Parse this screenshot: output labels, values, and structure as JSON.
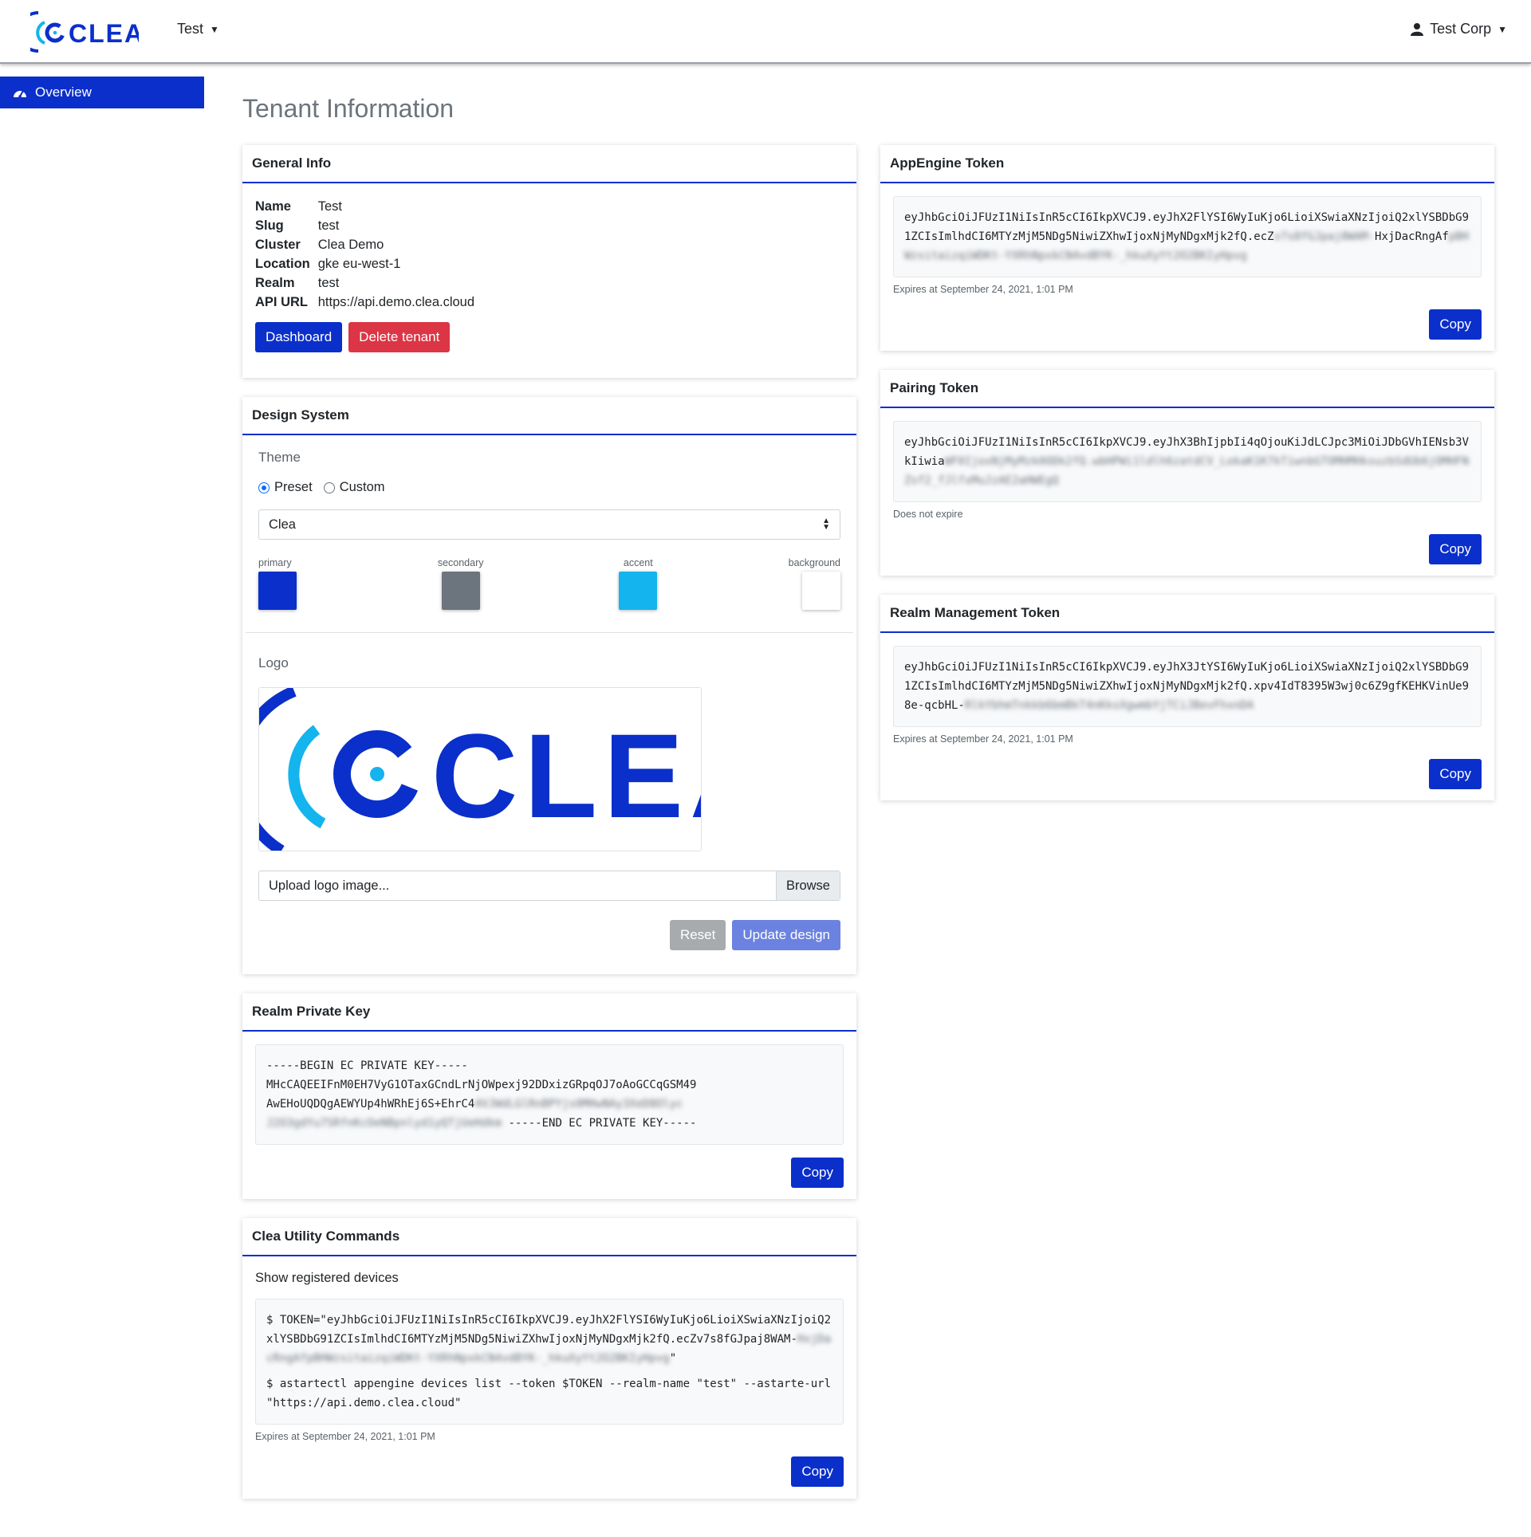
{
  "header": {
    "tenant_selector": "Test",
    "user_menu": "Test Corp"
  },
  "sidebar": {
    "items": [
      {
        "label": "Overview",
        "icon": "dashboard-icon"
      }
    ]
  },
  "page": {
    "title": "Tenant Information"
  },
  "general_info": {
    "title": "General Info",
    "fields": [
      {
        "key": "Name",
        "value": "Test"
      },
      {
        "key": "Slug",
        "value": "test"
      },
      {
        "key": "Cluster",
        "value": "Clea Demo"
      },
      {
        "key": "Location",
        "value": "gke eu-west-1"
      },
      {
        "key": "Realm",
        "value": "test"
      },
      {
        "key": "API URL",
        "value": "https://api.demo.clea.cloud"
      }
    ],
    "dashboard_button": "Dashboard",
    "delete_button": "Delete tenant"
  },
  "design_system": {
    "title": "Design System",
    "theme_label": "Theme",
    "preset_label": "Preset",
    "custom_label": "Custom",
    "selected_theme": "Clea",
    "swatches": [
      {
        "label": "primary",
        "color": "#0a2fca"
      },
      {
        "label": "secondary",
        "color": "#6c757d"
      },
      {
        "label": "accent",
        "color": "#14b4ee"
      },
      {
        "label": "background",
        "color": "#ffffff"
      }
    ],
    "logo_label": "Logo",
    "logo_text": "CLEA",
    "upload_placeholder": "Upload logo image...",
    "browse_label": "Browse",
    "reset_button": "Reset",
    "update_button": "Update design"
  },
  "realm_private_key": {
    "title": "Realm Private Key",
    "line1": "-----BEGIN EC PRIVATE KEY-----",
    "line2": "MHcCAQEEIFnM0EH7VyG1OTaxGCndLrNjOWpexj92DDxizGRpqOJ7oAoGCCqGSM49",
    "line3a": "AwEHoUQDQgAEWYUp4hWRhEj6S+EhrC4",
    "line3b": "4VJWdLGlRnBPYjs0MHwNAy3XeD8Olyc",
    "line4a": "J2O3gdYu7SRfnKcOeNBpnlyd1yQTjUeHdkm",
    "line4b": " -----END EC PRIVATE KEY-----",
    "copy_button": "Copy"
  },
  "utility_commands": {
    "title": "Clea Utility Commands",
    "subtitle": "Show registered devices",
    "cmd1a": "$ TOKEN=\"eyJhbGciOiJFUzI1NiIsInR5cCI6IkpXVCJ9.eyJhX2FlYSI6WyIuKjo6LioiXSwiaXNzIjoiQ2xlYSBDbG91ZCIsImlhdCI6MTYzMjM5NDg5NiwiZXhwIjoxNjMyNDgxMjk2fQ.ecZv7s8fGJpaj8WAM-",
    "cmd1b": "HxjDacRngAfpBHWzsitaizqiWDKt-YXRhNpxkCN4vdBYK-_hkuXyYt2O2BKIyHpvg",
    "cmd1c": "\"",
    "cmd2": "$ astartectl appengine devices list --token $TOKEN --realm-name \"test\" --astarte-url \"https://api.demo.clea.cloud\"",
    "expiry": "Expires at September 24, 2021, 1:01 PM",
    "copy_button": "Copy"
  },
  "appengine_token": {
    "title": "AppEngine Token",
    "token_visible": "eyJhbGciOiJFUzI1NiIsInR5cCI6IkpXVCJ9.eyJhX2FlYSI6WyIuKjo6LioiXSwiaXNzIjoiQ2xlYSBDbG91ZCIsImlhdCI6MTYzMjM5NDg5NiwiZXhwIjoxNjMyNDgxMjk2fQ.ecZ",
    "token_blurred_a": "v7s8fGJpaj8WAM-",
    "token_line3a": "HxjDacRngAf",
    "token_blurred_b": "pBHWzsitaizqiWDKt-YXRhNpxkCN4vdBYK-_hkuXyYt2O2BKIyHpvg",
    "expiry": "Expires at September 24, 2021, 1:01 PM",
    "copy_button": "Copy"
  },
  "pairing_token": {
    "title": "Pairing Token",
    "token_visible": "eyJhbGciOiJFUzI1NiIsInR5cCI6IkpXVCJ9.eyJhX3BhIjpbIi4qOjouKiJdLCJpc3MiOiJDbGVhIENsb3VkIiwia",
    "token_blurred": "WF0IjoxNjMyMzk0ODk2fQ.wbHPWi1ldlh6zatdCV_LokaK1K7kTiwnbGTOMHMHksuzbSdUb6jOMHFNZsf2_fJlfxMuJzAE2aHWEgQ",
    "expiry": "Does not expire",
    "copy_button": "Copy"
  },
  "realm_mgmt_token": {
    "title": "Realm Management Token",
    "token_visible": "eyJhbGciOiJFUzI1NiIsInR5cCI6IkpXVCJ9.eyJhX3JtYSI6WyIuKjo6LioiXSwiaXNzIjoiQ2xlYSBDbG91ZCIsImlhdCI6MTYzMjM5NDg5NiwiZXhwIjoxNjMyNDgxMjk2fQ.xpv4IdT8395W3wj0c6Z9gfKEHKVinUe98e-qcbHL-",
    "token_blurred": "RlkYbhmTnkkb6bmBkT4nKksXgwmbYjTCiJBevFhxnDA",
    "expiry": "Expires at September 24, 2021, 1:01 PM",
    "copy_button": "Copy"
  }
}
